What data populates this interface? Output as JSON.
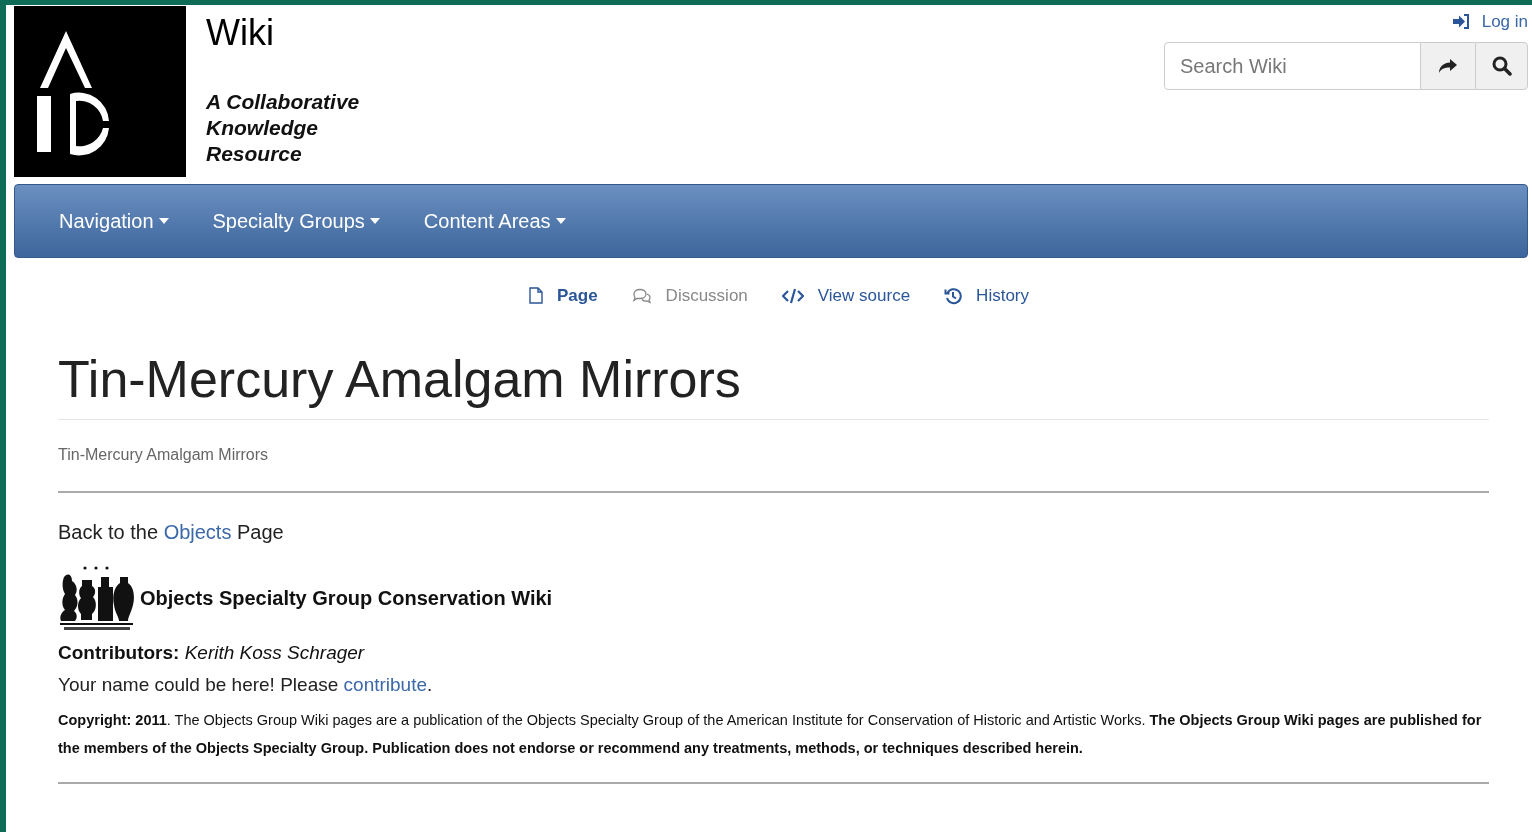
{
  "header": {
    "site_title": "Wiki",
    "tagline": "A Collaborative Knowledge Resource",
    "login": "Log in",
    "search": {
      "placeholder": "Search Wiki"
    }
  },
  "navbar": [
    {
      "label": "Navigation"
    },
    {
      "label": "Specialty Groups"
    },
    {
      "label": "Content Areas"
    }
  ],
  "page_tabs": [
    {
      "kind": "page",
      "label": "Page",
      "selected": true,
      "missing": false
    },
    {
      "kind": "discussion",
      "label": "Discussion",
      "selected": false,
      "missing": true
    },
    {
      "kind": "source",
      "label": "View source",
      "selected": false,
      "missing": false
    },
    {
      "kind": "history",
      "label": "History",
      "selected": false,
      "missing": false
    }
  ],
  "title": "Tin-Mercury Amalgam Mirrors",
  "breadcrumb": "Tin-Mercury Amalgam Mirrors",
  "content": {
    "back": {
      "before": "Back to the ",
      "link": "Objects",
      "after": " Page"
    },
    "banner": "Objects Specialty Group Conservation Wiki",
    "contributors": "**Contributors:** *Kerith Koss Schrager*",
    "invite": {
      "before": "Your name could be here! Please ",
      "link": "contribute",
      "after": "."
    },
    "copyright": "**Copyright: 2011**. The Objects Group Wiki pages are a publication of the Objects Specialty Group of the American Institute for Conservation of Historic and Artistic Works. **The Objects Group Wiki pages are published for the members of the Objects Specialty Group. Publication does not endorse or recommend any treatments, methods, or techniques described herein.**"
  }
}
